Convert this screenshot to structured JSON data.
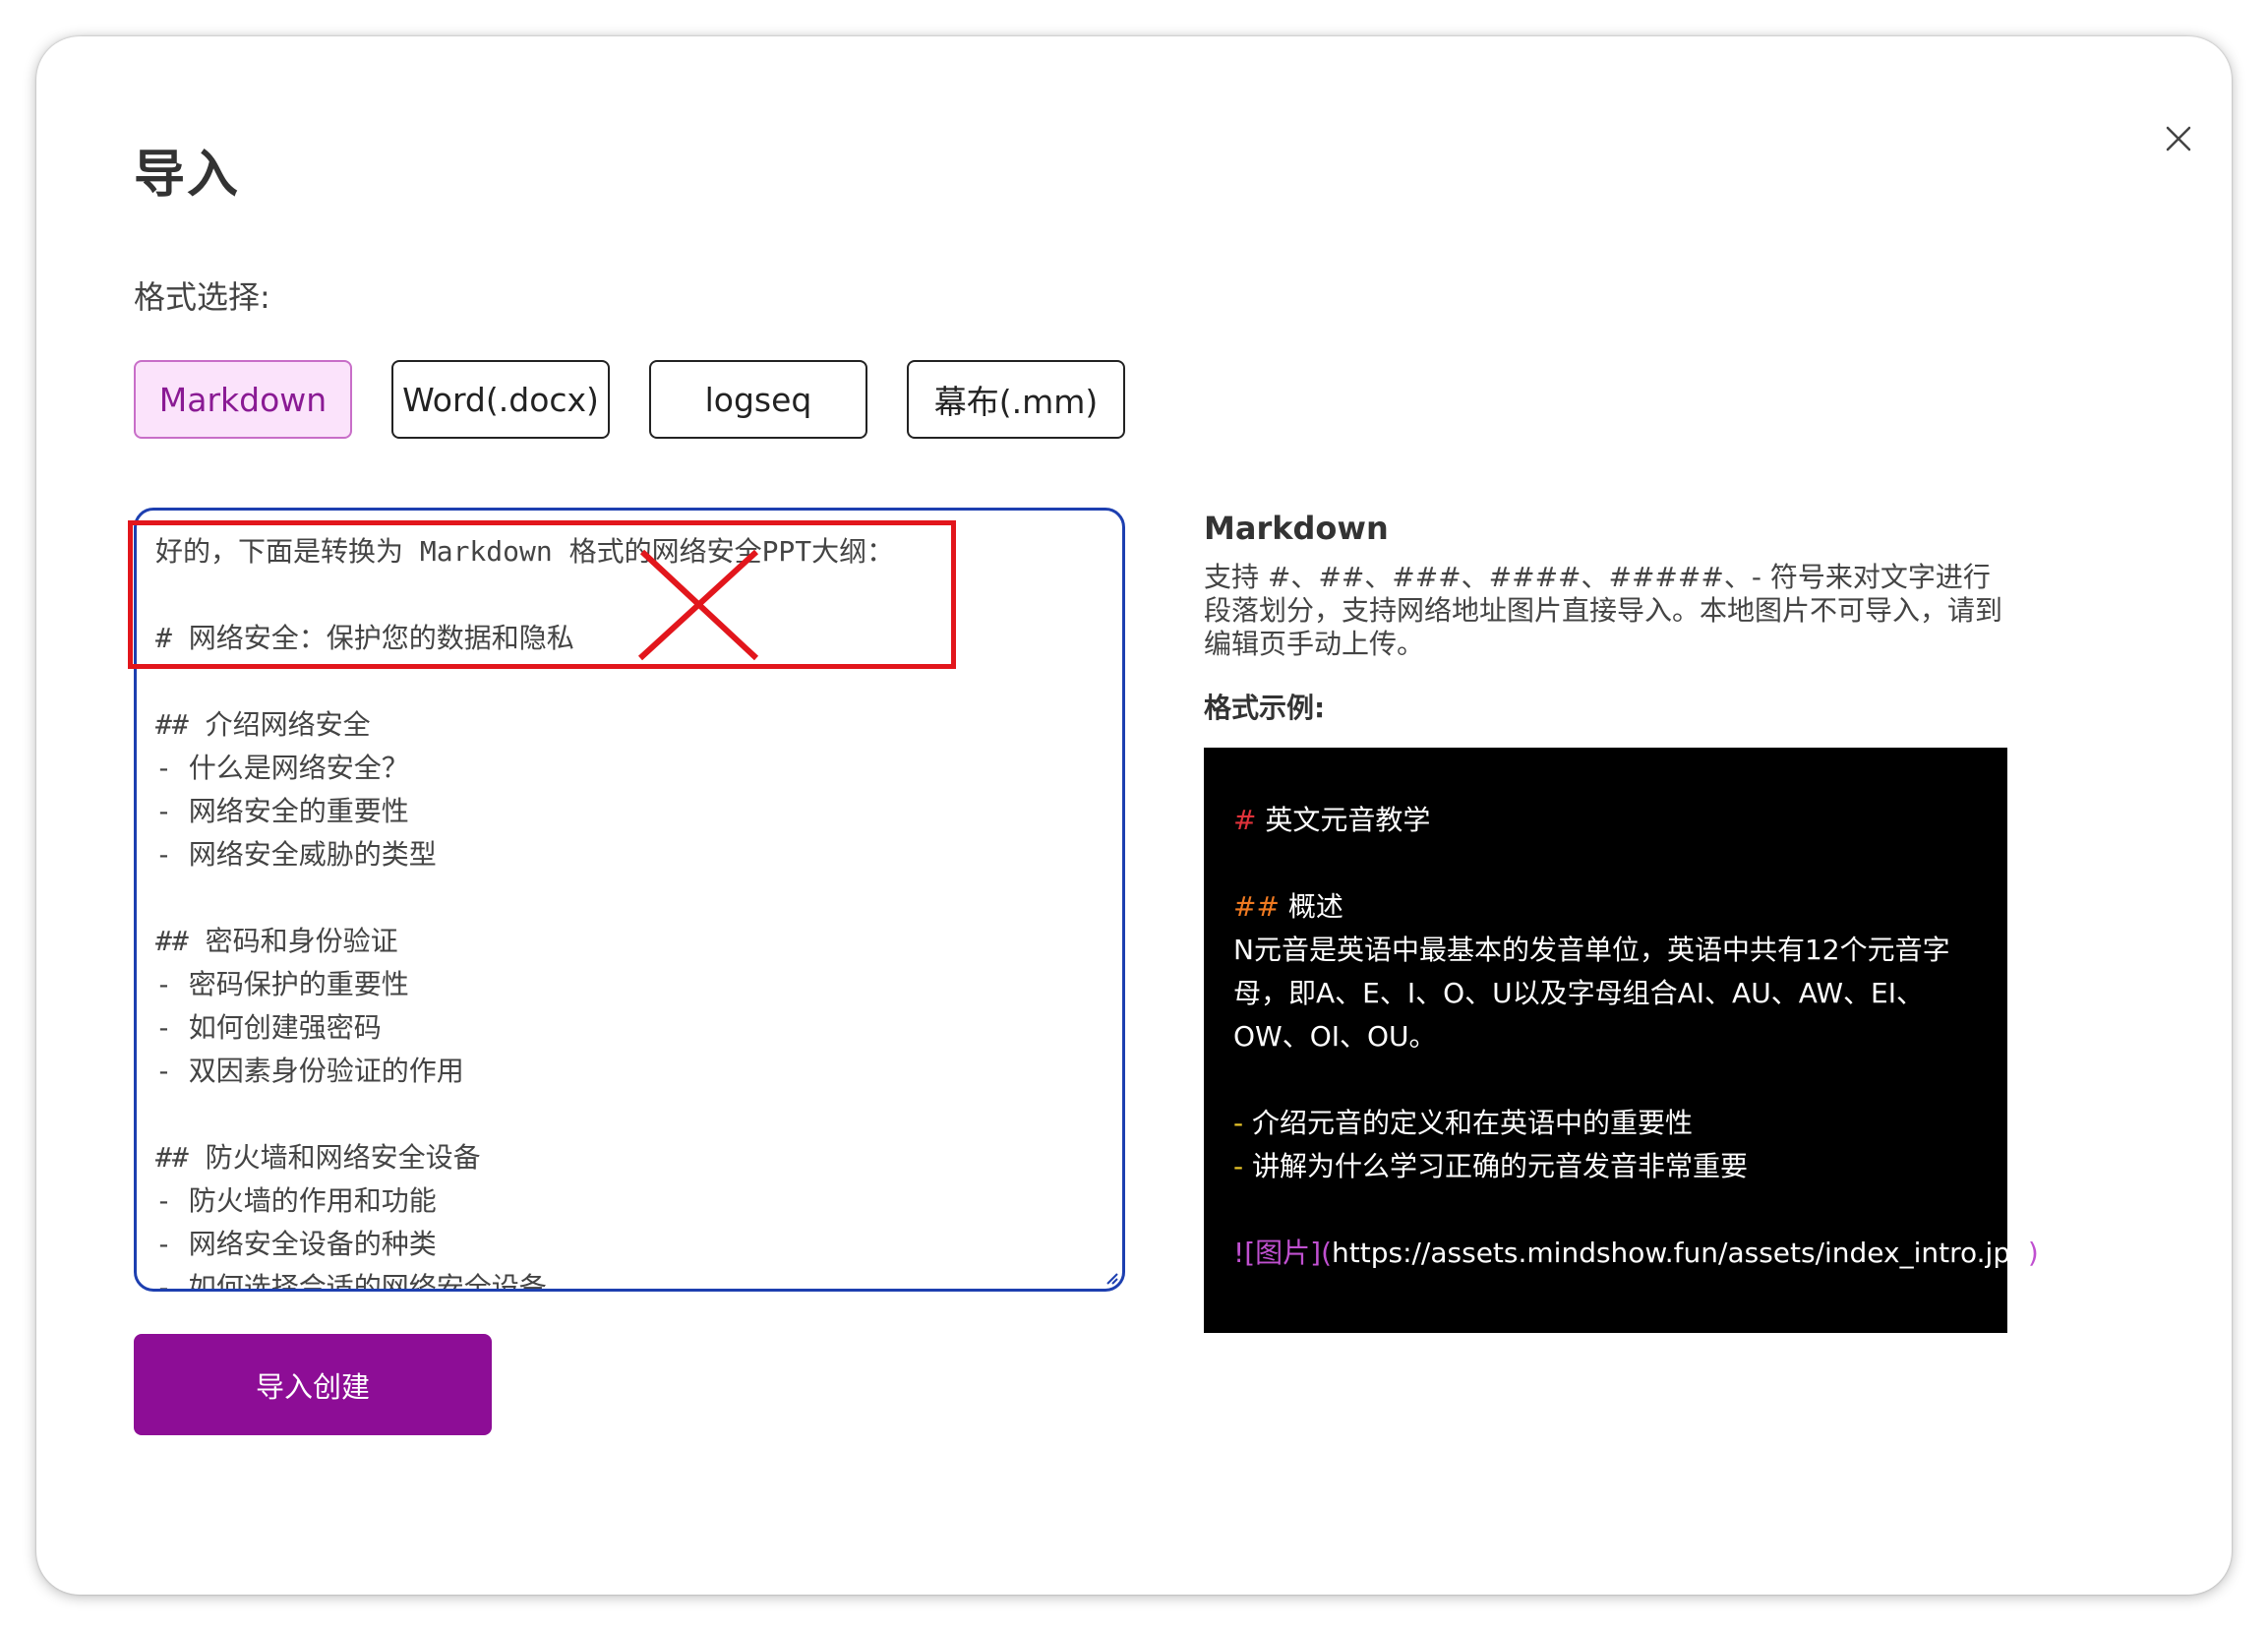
{
  "dialog": {
    "title": "导入",
    "format_label": "格式选择:",
    "close_icon": "close-icon"
  },
  "formats": [
    {
      "label": "Markdown",
      "selected": true
    },
    {
      "label": "Word(.docx)",
      "selected": false
    },
    {
      "label": "logseq",
      "selected": false
    },
    {
      "label": "幕布(.mm)",
      "selected": false
    }
  ],
  "editor": {
    "value": "好的，下面是转换为 Markdown 格式的网络安全PPT大纲：\n\n# 网络安全：保护您的数据和隐私\n\n## 介绍网络安全\n- 什么是网络安全？\n- 网络安全的重要性\n- 网络安全威胁的类型\n\n## 密码和身份验证\n- 密码保护的重要性\n- 如何创建强密码\n- 双因素身份验证的作用\n\n## 防火墙和网络安全设备\n- 防火墙的作用和功能\n- 网络安全设备的种类\n- 如何选择合适的网络安全设备"
  },
  "submit": {
    "label": "导入创建"
  },
  "info": {
    "title": "Markdown",
    "desc": "支持 #、##、###、####、#####、- 符号来对文字进行段落划分，支持网络地址图片直接导入。本地图片不可导入，请到编辑页手动上传。",
    "example_label": "格式示例:"
  },
  "example": {
    "h1_marker": "#",
    "h1_text": " 英文元音教学",
    "h2_marker": "##",
    "h2_text": " 概述",
    "para_line1": " N元音是英语中最基本的发音单位，英语中共有12个元音字",
    "para_line2": "母，即A、E、I、O、U以及字母组合AI、AU、AW、EI、",
    "para_line3": "OW、OI、OU。",
    "bullet_marker": "-",
    "bullet1": " 介绍元音的定义和在英语中的重要性",
    "bullet2": " 讲解为什么学习正确的元音发音非常重要",
    "img_open": "![图片](",
    "img_url": "https://assets.mindshow.fun/assets/index_intro.jpg",
    "img_close": ")"
  },
  "annotation": {
    "color": "#e2161c",
    "icon": "red-x-mark-icon"
  },
  "colors": {
    "accent": "#8d0d96",
    "selected_bg": "#fbe3fb",
    "editor_border": "#1d3fb0"
  }
}
